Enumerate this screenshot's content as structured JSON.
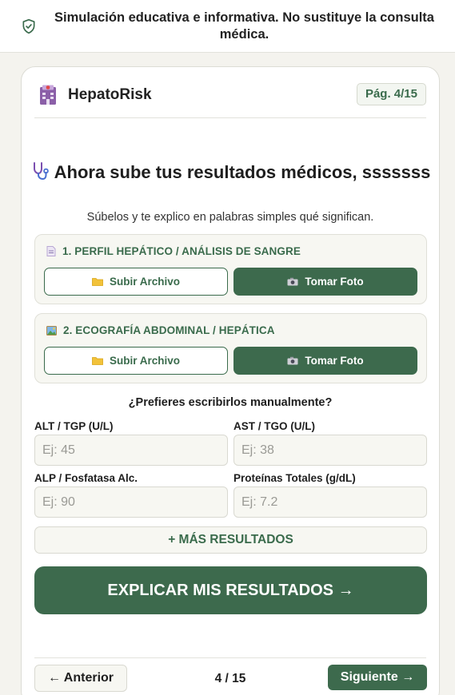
{
  "banner": {
    "icon": "shield-check-icon",
    "text": "Simulación educativa e informativa. No sustituye la consulta médica."
  },
  "header": {
    "logo_icon": "clinic-building-icon",
    "app_name": "HepatoRisk",
    "page_badge": "Pág. 4/15"
  },
  "main": {
    "title_icon": "stethoscope-icon",
    "title": "Ahora sube tus resultados médicos, sssssss",
    "subtitle": "Súbelos y te explico en palabras simples qué significan.",
    "sections": [
      {
        "icon": "document-icon",
        "heading": "1. PERFIL HEPÁTICO / ANÁLISIS DE SANGRE",
        "upload_icon": "folder-icon",
        "upload_label": "Subir Archivo",
        "photo_icon": "camera-icon",
        "photo_label": "Tomar Foto"
      },
      {
        "icon": "image-icon",
        "heading": "2. ECOGRAFÍA ABDOMINAL / HEPÁTICA",
        "upload_icon": "folder-icon",
        "upload_label": "Subir Archivo",
        "photo_icon": "camera-icon",
        "photo_label": "Tomar Foto"
      }
    ],
    "manual_prompt": "¿Prefieres escribirlos manualmente?",
    "fields": [
      {
        "label": "ALT / TGP (U/L)",
        "placeholder": "Ej: 45",
        "value": ""
      },
      {
        "label": "AST / TGO (U/L)",
        "placeholder": "Ej: 38",
        "value": ""
      },
      {
        "label": "ALP / Fosfatasa Alc.",
        "placeholder": "Ej: 90",
        "value": ""
      },
      {
        "label": "Proteínas Totales (g/dL)",
        "placeholder": "Ej: 7.2",
        "value": ""
      }
    ],
    "more_results_label": "+ MÁS RESULTADOS",
    "explain_label": "EXPLICAR MIS RESULTADOS →"
  },
  "footer": {
    "prev_label": "← Anterior",
    "page_counter": "4 / 15",
    "next_label": "Siguiente →"
  },
  "colors": {
    "accent": "#3d6a4d",
    "background": "#f4f3ee",
    "card": "#ffffff",
    "field_bg": "#f7f7f2"
  }
}
